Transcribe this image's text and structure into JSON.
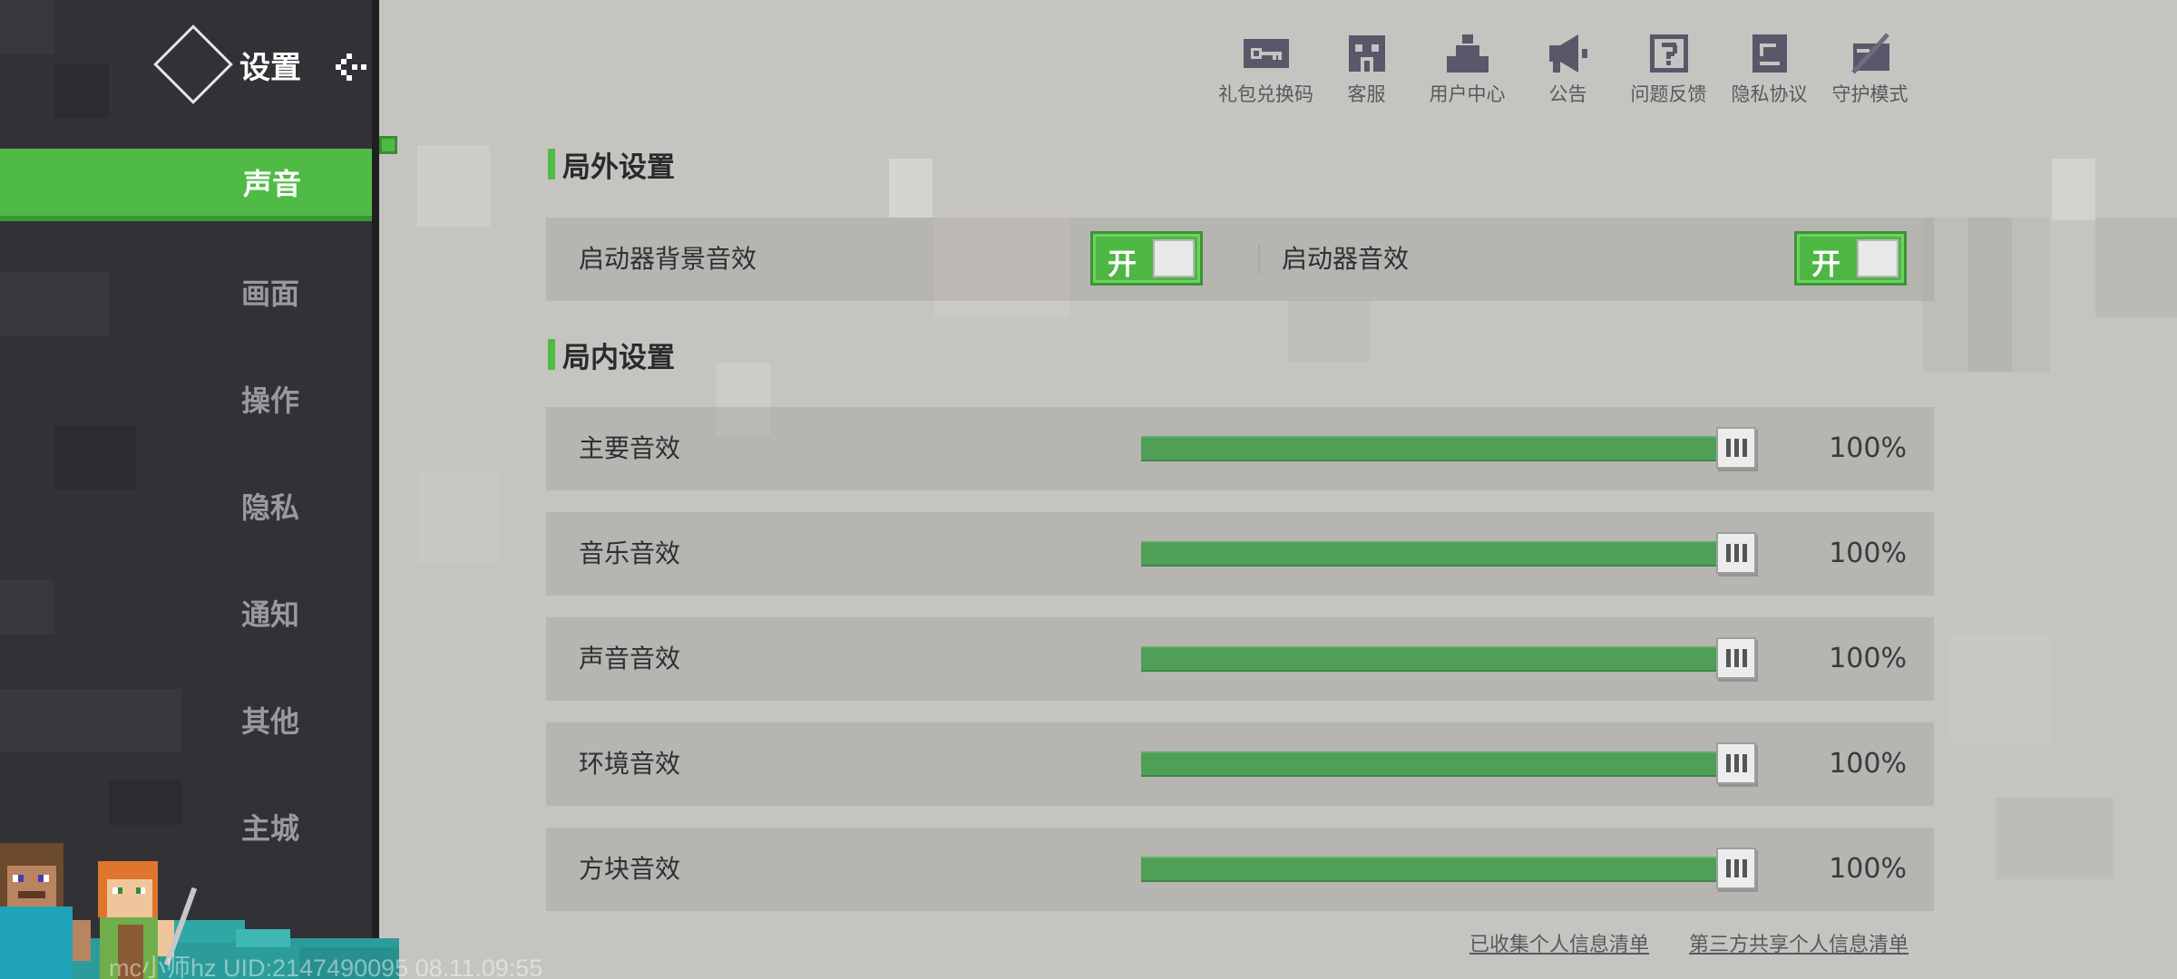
{
  "sidebar": {
    "title": "设置",
    "items": [
      {
        "label": "声音"
      },
      {
        "label": "画面"
      },
      {
        "label": "操作"
      },
      {
        "label": "隐私"
      },
      {
        "label": "通知"
      },
      {
        "label": "其他"
      },
      {
        "label": "主城"
      }
    ],
    "active_index": 0
  },
  "toolbar": {
    "items": [
      {
        "label": "礼包兑换码",
        "icon": "key-icon"
      },
      {
        "label": "客服",
        "icon": "customer-service-icon"
      },
      {
        "label": "用户中心",
        "icon": "user-center-icon"
      },
      {
        "label": "公告",
        "icon": "megaphone-icon"
      },
      {
        "label": "问题反馈",
        "icon": "question-icon"
      },
      {
        "label": "隐私协议",
        "icon": "document-icon"
      },
      {
        "label": "守护模式",
        "icon": "guardian-icon"
      }
    ]
  },
  "outside": {
    "title": "局外设置",
    "launcher_bg": {
      "label": "启动器背景音效",
      "state": "开"
    },
    "launcher_sfx": {
      "label": "启动器音效",
      "state": "开"
    }
  },
  "inside": {
    "title": "局内设置",
    "sliders": [
      {
        "label": "主要音效",
        "value": "100%",
        "level": 1.0
      },
      {
        "label": "音乐音效",
        "value": "100%",
        "level": 1.0
      },
      {
        "label": "声音音效",
        "value": "100%",
        "level": 1.0
      },
      {
        "label": "环境音效",
        "value": "100%",
        "level": 1.0
      },
      {
        "label": "方块音效",
        "value": "100%",
        "level": 1.0
      }
    ]
  },
  "footer": {
    "collected": "已收集个人信息清单",
    "third_party": "第三方共享个人信息清单"
  },
  "watermark": "mc小师hz UID:2147490095 08.11.09:55",
  "colors": {
    "accent": "#4fbb45",
    "sidebar": "#313136",
    "slider": "#4f9f57",
    "background": "#c6c4c1"
  }
}
